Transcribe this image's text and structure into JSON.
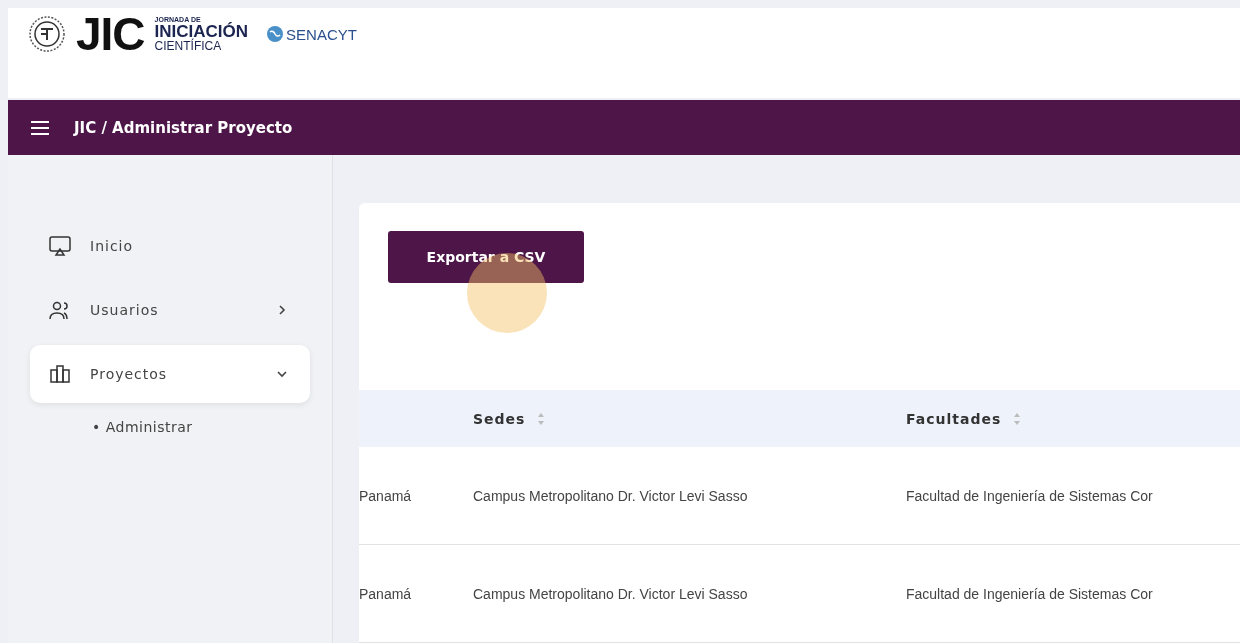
{
  "logo": {
    "jic": "JIC",
    "line_1": "JORNADA DE",
    "line_2": "INICIACIÓN",
    "line_3": "CIENTÍFICA",
    "partner": "SENACYT"
  },
  "topbar": {
    "breadcrumb": "JIC / Administrar Proyecto"
  },
  "sidebar": {
    "items": [
      {
        "label": "Inicio",
        "kind": "link",
        "selected": false
      },
      {
        "label": "Usuarios",
        "kind": "group",
        "selected": false,
        "expanded": false
      },
      {
        "label": "Proyectos",
        "kind": "group",
        "selected": true,
        "expanded": true,
        "children": [
          {
            "bullet": "•",
            "label": "Administrar"
          }
        ]
      }
    ]
  },
  "export_button": "Exportar a CSV",
  "table": {
    "columns": [
      {},
      {
        "label": "Sedes"
      },
      {
        "label": "Facultades"
      }
    ],
    "rows": [
      [
        "Panamá",
        "Campus Metropolitano Dr. Victor Levi Sasso",
        "Facultad de Ingeniería de Sistemas Cor"
      ],
      [
        "Panamá",
        "Campus Metropolitano Dr. Victor Levi Sasso",
        "Facultad de Ingeniería de Sistemas Cor"
      ]
    ]
  }
}
